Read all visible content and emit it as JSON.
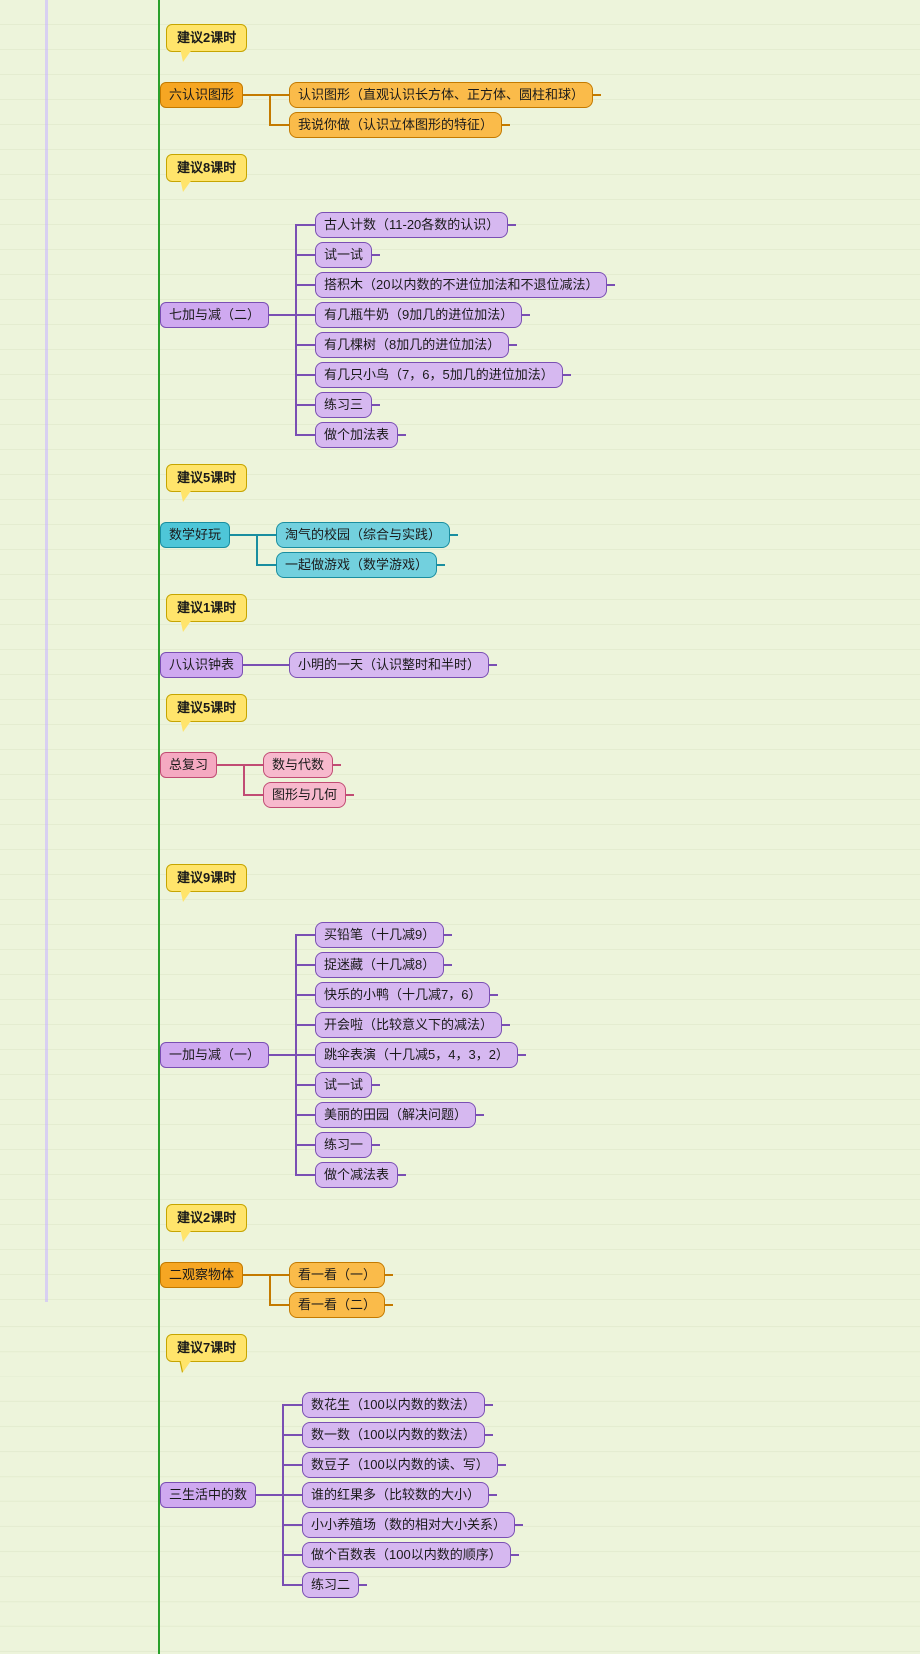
{
  "sections": [
    {
      "id": "s6",
      "color": "orange",
      "badge": "建议2课时",
      "title": "六认识图形",
      "children": [
        "认识图形（直观认识长方体、正方体、圆柱和球）",
        "我说你做（认识立体图形的特征）"
      ]
    },
    {
      "id": "s7",
      "color": "purple",
      "badge": "建议8课时",
      "title": "七加与减（二）",
      "children": [
        "古人计数（11-20各数的认识）",
        "试一试",
        "搭积木（20以内数的不进位加法和不退位减法）",
        "有几瓶牛奶（9加几的进位加法）",
        "有几棵树（8加几的进位加法）",
        "有几只小鸟（7，6，5加几的进位加法）",
        "练习三",
        "做个加法表"
      ]
    },
    {
      "id": "sFun",
      "color": "teal",
      "badge": "建议5课时",
      "title": "数学好玩",
      "children": [
        "淘气的校园（综合与实践）",
        "一起做游戏（数学游戏）"
      ]
    },
    {
      "id": "s8",
      "color": "purple",
      "badge": "建议1课时",
      "title": "八认识钟表",
      "children": [
        "小明的一天（认识整时和半时）"
      ]
    },
    {
      "id": "sRev",
      "color": "pink",
      "badge": "建议5课时",
      "title": "总复习",
      "children": [
        "数与代数",
        "图形与几何"
      ]
    },
    {
      "id": "s1",
      "color": "purple",
      "badge": "建议9课时",
      "title": "一加与减（一）",
      "children": [
        "买铅笔（十几减9）",
        "捉迷藏（十几减8）",
        "快乐的小鸭（十几减7，6）",
        "开会啦（比较意义下的减法）",
        "跳伞表演（十几减5，4，3，2）",
        "试一试",
        "美丽的田园（解决问题）",
        "练习一",
        "做个减法表"
      ]
    },
    {
      "id": "s2",
      "color": "orange",
      "badge": "建议2课时",
      "title": "二观察物体",
      "children": [
        "看一看（一）",
        "看一看（二）"
      ]
    },
    {
      "id": "s3",
      "color": "purple",
      "badge": "建议7课时",
      "title": "三生活中的数",
      "children": [
        "数花生（100以内数的数法）",
        "数一数（100以内数的数法）",
        "数豆子（100以内数的读、写）",
        "谁的红果多（比较数的大小）",
        "小小养殖场（数的相对大小关系）",
        "做个百数表（100以内数的顺序）",
        "练习二"
      ]
    }
  ]
}
